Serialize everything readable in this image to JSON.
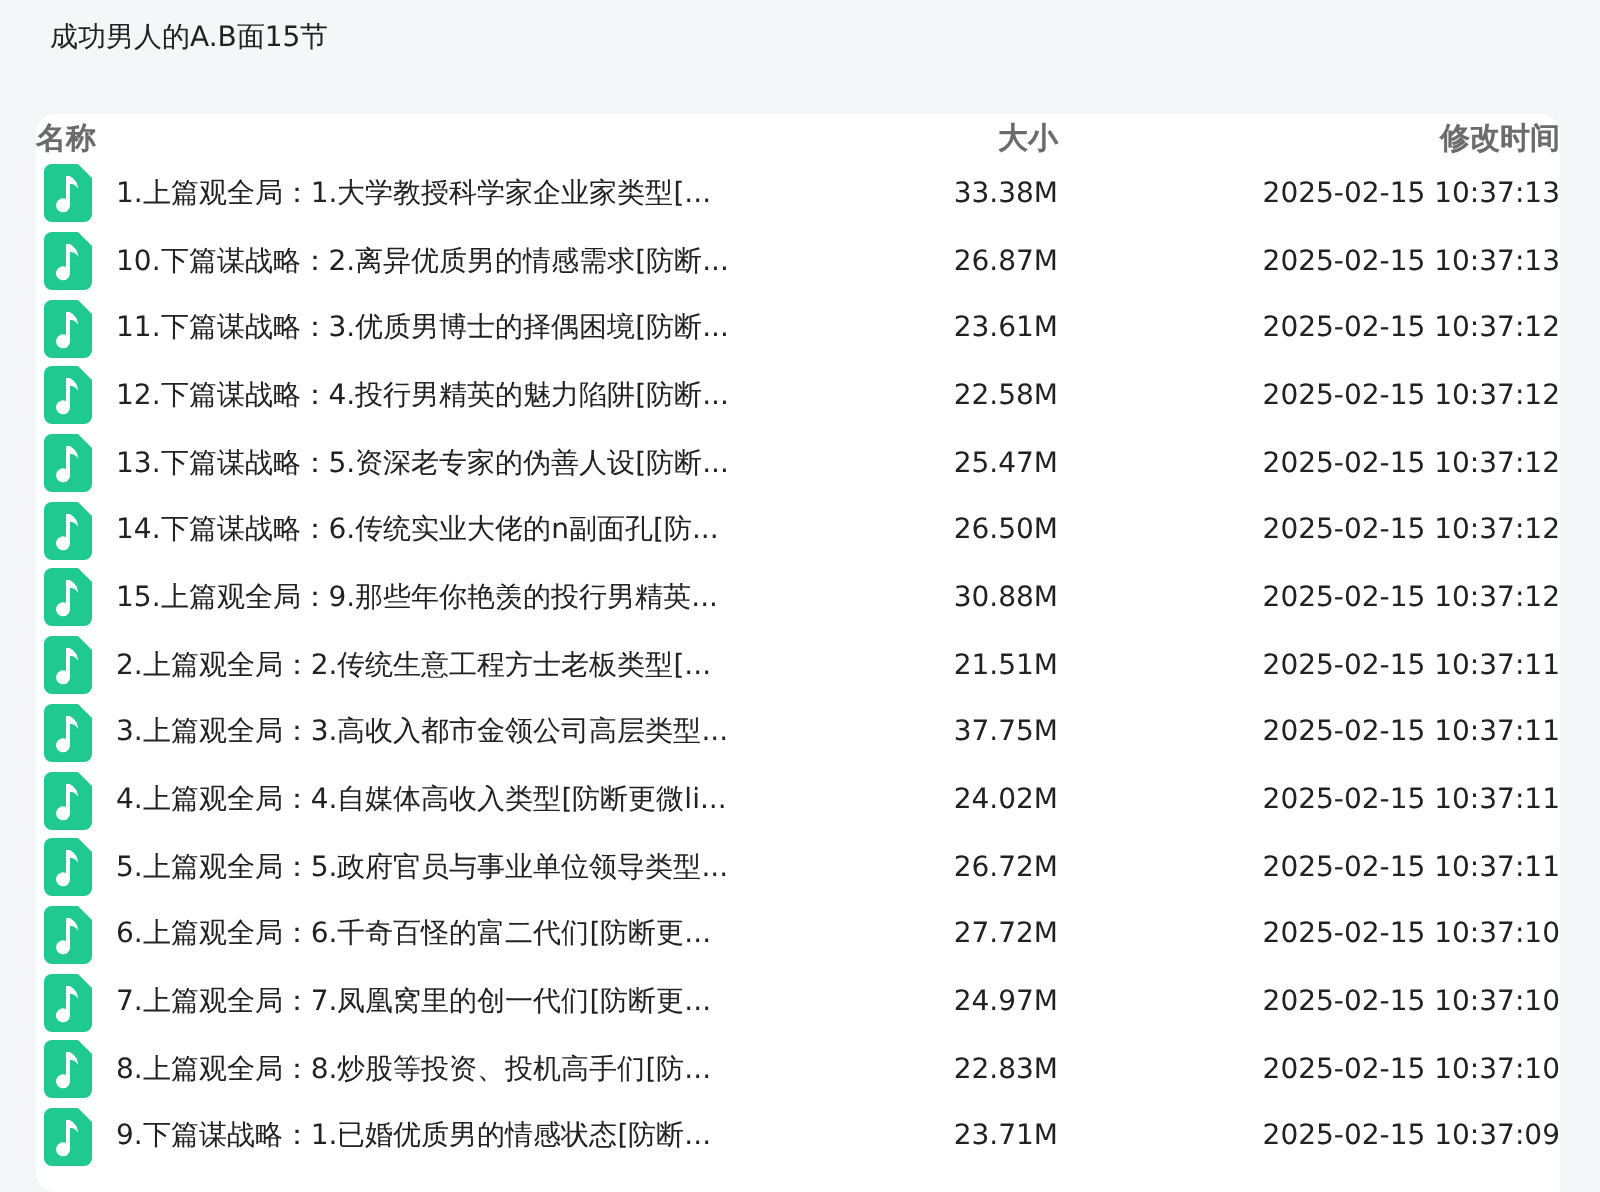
{
  "title": "成功男人的A.B面15节",
  "columns": [
    "名称",
    "大小",
    "修改时间"
  ],
  "rows": [
    {
      "name": "1.上篇观全局：1.大学教授科学家企业家类型[...",
      "size": "33.38M",
      "modified": "2025-02-15 10:37:13"
    },
    {
      "name": "10.下篇谋战略：2.离异优质男的情感需求[防断...",
      "size": "26.87M",
      "modified": "2025-02-15 10:37:13"
    },
    {
      "name": "11.下篇谋战略：3.优质男博士的择偶困境[防断...",
      "size": "23.61M",
      "modified": "2025-02-15 10:37:12"
    },
    {
      "name": "12.下篇谋战略：4.投行男精英的魅力陷阱[防断...",
      "size": "22.58M",
      "modified": "2025-02-15 10:37:12"
    },
    {
      "name": "13.下篇谋战略：5.资深老专家的伪善人设[防断...",
      "size": "25.47M",
      "modified": "2025-02-15 10:37:12"
    },
    {
      "name": "14.下篇谋战略：6.传统实业大佬的n副面孔[防...",
      "size": "26.50M",
      "modified": "2025-02-15 10:37:12"
    },
    {
      "name": "15.上篇观全局：9.那些年你艳羡的投行男精英...",
      "size": "30.88M",
      "modified": "2025-02-15 10:37:12"
    },
    {
      "name": "2.上篇观全局：2.传统生意工程方士老板类型[...",
      "size": "21.51M",
      "modified": "2025-02-15 10:37:11"
    },
    {
      "name": "3.上篇观全局：3.高收入都市金领公司高层类型...",
      "size": "37.75M",
      "modified": "2025-02-15 10:37:11"
    },
    {
      "name": "4.上篇观全局：4.自媒体高收入类型[防断更微li...",
      "size": "24.02M",
      "modified": "2025-02-15 10:37:11"
    },
    {
      "name": "5.上篇观全局：5.政府官员与事业单位领导类型...",
      "size": "26.72M",
      "modified": "2025-02-15 10:37:11"
    },
    {
      "name": "6.上篇观全局：6.千奇百怪的富二代们[防断更...",
      "size": "27.72M",
      "modified": "2025-02-15 10:37:10"
    },
    {
      "name": "7.上篇观全局：7.凤凰窝里的创一代们[防断更...",
      "size": "24.97M",
      "modified": "2025-02-15 10:37:10"
    },
    {
      "name": "8.上篇观全局：8.炒股等投资、投机高手们[防...",
      "size": "22.83M",
      "modified": "2025-02-15 10:37:10"
    },
    {
      "name": "9.下篇谋战略：1.已婚优质男的情感状态[防断...",
      "size": "23.71M",
      "modified": "2025-02-15 10:37:09"
    }
  ]
}
